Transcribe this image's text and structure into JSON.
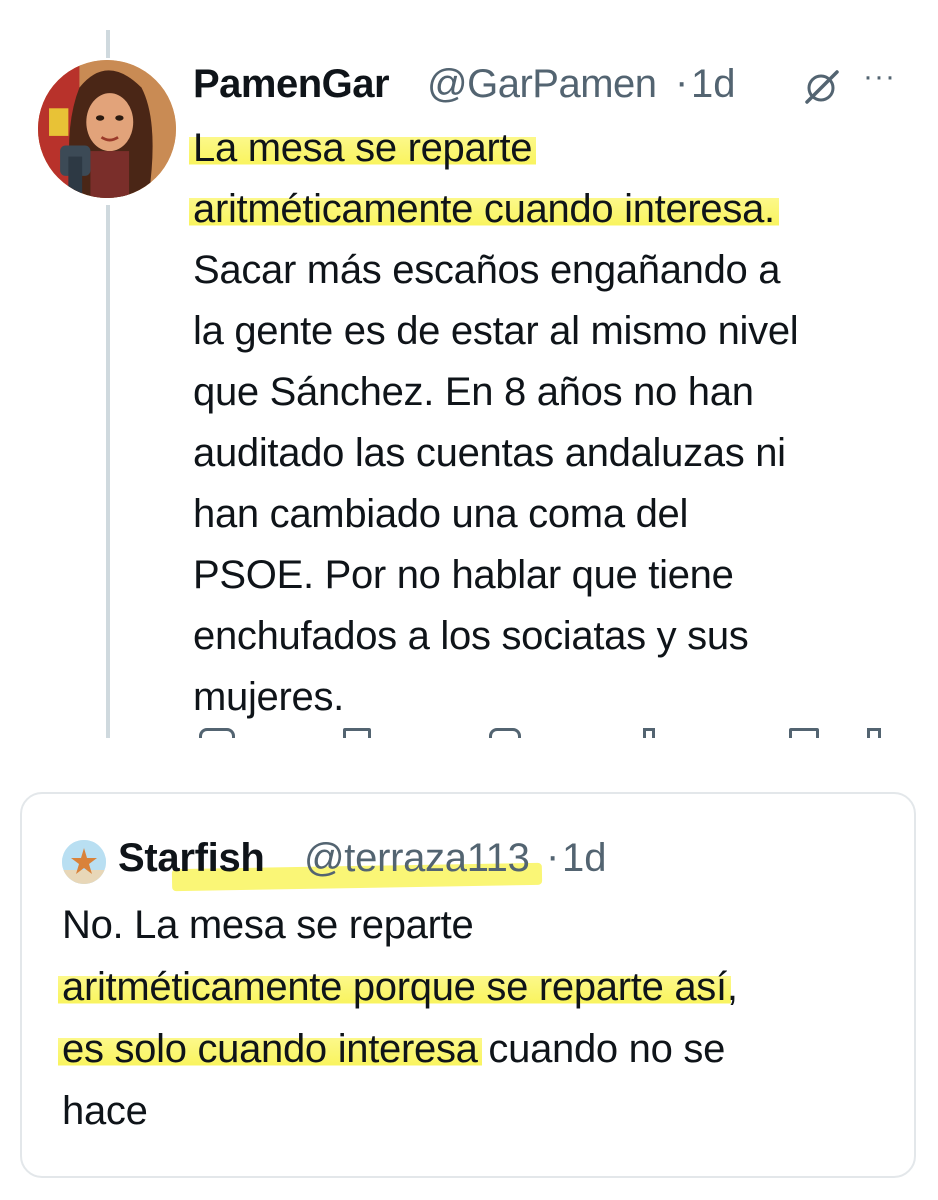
{
  "colors": {
    "highlight": "#f9f45e",
    "text": "#0f1419",
    "secondary": "#536471",
    "border": "#e3e7ea"
  },
  "tweet": {
    "author_name": "PamenGar",
    "author_handle": "@GarPamen",
    "separator": "·",
    "time": "1d",
    "icons": [
      "grok-icon",
      "more-icon"
    ],
    "more_label": "···",
    "body_lines": [
      {
        "text": "La mesa se reparte",
        "highlighted": true
      },
      {
        "text": "aritméticamente cuando interesa.",
        "highlighted": true
      },
      {
        "text": "Sacar más escaños engañando a",
        "highlighted": false
      },
      {
        "text": "la gente es de estar al mismo nivel",
        "highlighted": false
      },
      {
        "text": "que Sánchez. En 8 años no han",
        "highlighted": false
      },
      {
        "text": "auditado las cuentas andaluzas ni",
        "highlighted": false
      },
      {
        "text": "han cambiado una coma del",
        "highlighted": false
      },
      {
        "text": "PSOE. Por no hablar que tiene",
        "highlighted": false
      },
      {
        "text": "enchufados a los sociatas y sus",
        "highlighted": false
      },
      {
        "text": "mujeres.",
        "highlighted": false
      }
    ]
  },
  "quoted_tweet": {
    "author_name": "Starfish",
    "author_handle": "@terraza113",
    "separator": "·",
    "time": "1d",
    "body_lines": [
      {
        "pre": "No. La mesa se reparte",
        "hl": "",
        "post": ""
      },
      {
        "pre": "",
        "hl": "aritméticamente porque se reparte así",
        "post": ","
      },
      {
        "pre": "",
        "hl": "es solo cuando interesa",
        "post": " cuando no se"
      },
      {
        "pre": "hace",
        "hl": "",
        "post": ""
      }
    ]
  }
}
